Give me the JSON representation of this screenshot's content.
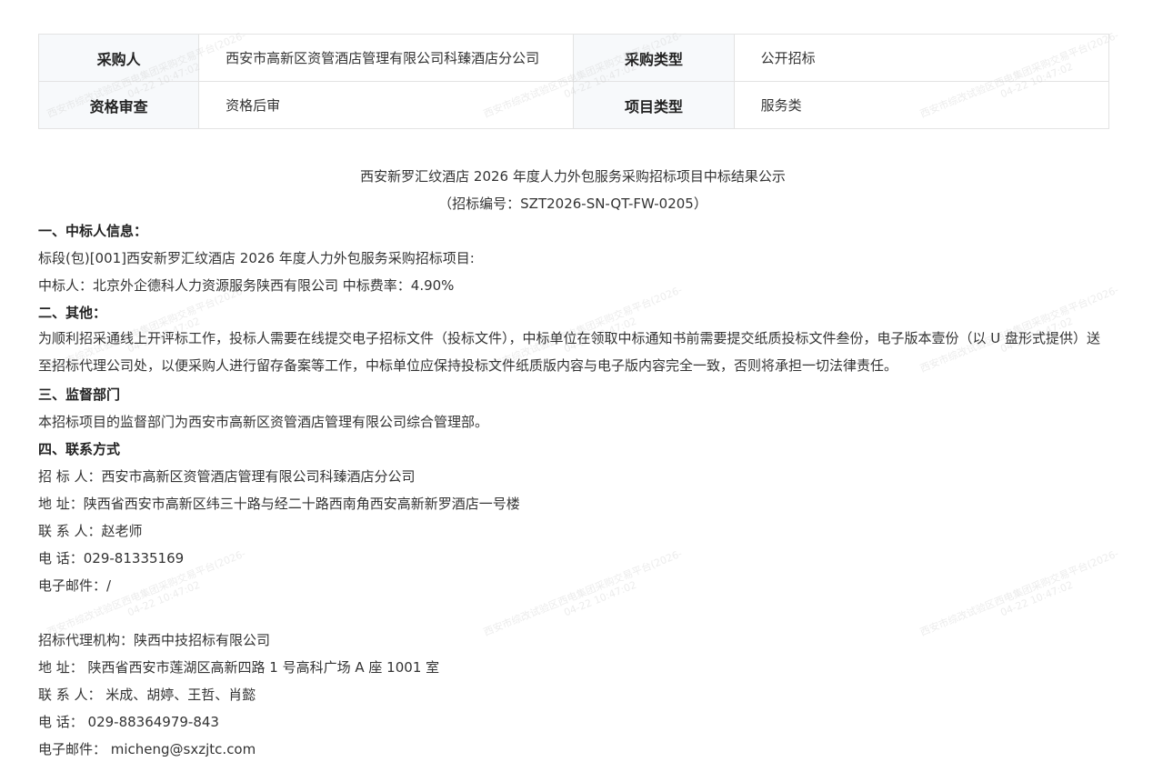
{
  "info_table": {
    "row1": {
      "label1": "采购人",
      "value1": "西安市高新区资管酒店管理有限公司科臻酒店分公司",
      "label2": "采购类型",
      "value2": "公开招标"
    },
    "row2": {
      "label1": "资格审查",
      "value1": "资格后审",
      "label2": "项目类型",
      "value2": "服务类"
    }
  },
  "watermark": {
    "line1": "西安市综改试验区西电集团采购交易平台(2026-",
    "line2": "04-22 10:47:02"
  },
  "announcement": {
    "title": "西安新罗汇纹酒店 2026 年度人力外包服务采购招标项目中标结果公示",
    "subtitle": "（招标编号：SZT2026-SN-QT-FW-0205）",
    "section1_heading": "一、中标人信息：",
    "section1_lot": "标段(包)[001]西安新罗汇纹酒店 2026 年度人力外包服务采购招标项目:",
    "section1_winner": "中标人：北京外企德科人力资源服务陕西有限公司 中标费率：4.90%",
    "section2_heading": "二、其他：",
    "section2_text": "为顺利招采通线上开评标工作，投标人需要在线提交电子招标文件（投标文件），中标单位在领取中标通知书前需要提交纸质投标文件叁份，电子版本壹份（以 U 盘形式提供）送至招标代理公司处，以便采购人进行留存备案等工作，中标单位应保持投标文件纸质版内容与电子版内容完全一致，否则将承担一切法律责任。",
    "section3_heading": "三、监督部门",
    "section3_text": "本招标项目的监督部门为西安市高新区资管酒店管理有限公司综合管理部。",
    "section4_heading": "四、联系方式",
    "tenderer": "招 标 人：西安市高新区资管酒店管理有限公司科臻酒店分公司",
    "tenderer_address": "地 址：陕西省西安市高新区纬三十路与经二十路西南角西安高新新罗酒店一号楼",
    "tenderer_contact": "联 系 人：赵老师",
    "tenderer_phone": "电 话：029-81335169",
    "tenderer_email": "电子邮件：/",
    "agency": "招标代理机构：陕西中技招标有限公司",
    "agency_address": "地 址： 陕西省西安市莲湖区高新四路 1 号高科广场 A 座 1001 室",
    "agency_contact": "联 系 人： 米成、胡婷、王哲、肖懿",
    "agency_phone": "电 话： 029-88364979-843",
    "agency_email": "电子邮件： micheng@sxzjtc.com"
  }
}
